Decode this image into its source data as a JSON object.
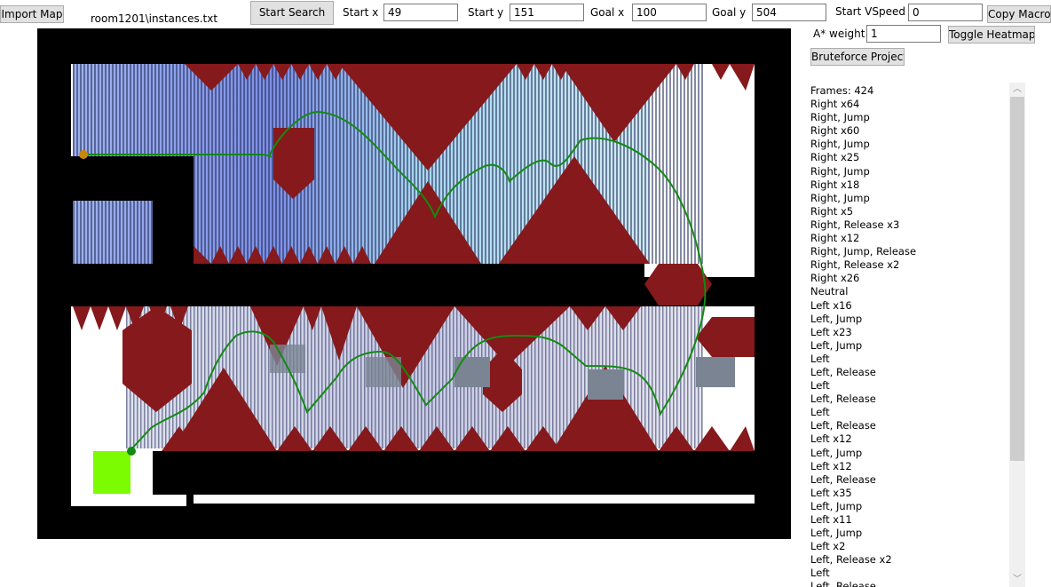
{
  "toolbar": {
    "import_label": "Import Map",
    "file_name": "room1201\\instances.txt",
    "start_search_label": "Start Search",
    "start_x_label": "Start x",
    "start_x_value": "49",
    "start_y_label": "Start y",
    "start_y_value": "151",
    "goal_x_label": "Goal x",
    "goal_x_value": "100",
    "goal_y_label": "Goal y",
    "goal_y_value": "504",
    "vspeed_label": "Start VSpeed",
    "vspeed_value": "0",
    "copy_macro_label": "Copy Macro",
    "astar_label": "A* weight",
    "astar_value": "1",
    "toggle_heatmap_label": "Toggle Heatmap",
    "bruteforce_label": "Bruteforce Project"
  },
  "map": {
    "colors": {
      "wall": "#000000",
      "hazard": "#85191b",
      "floor": "#ffffff",
      "goal": "#7cfc00",
      "path": "#138a13",
      "start_marker": "#c8860a",
      "block": "#7a8493"
    },
    "icons": [
      "start-marker",
      "goal-block",
      "player-dot"
    ]
  },
  "log": {
    "items": [
      "Frames: 424",
      "Right x64",
      "Right, Jump",
      "Right x60",
      "Right, Jump",
      "Right x25",
      "Right, Jump",
      "Right x18",
      "Right, Jump",
      "Right x5",
      "Right, Release x3",
      "Right x12",
      "Right, Jump, Release",
      "Right, Release x2",
      "Right x26",
      "Neutral",
      "Left x16",
      "Left, Jump",
      "Left x23",
      "Left, Jump",
      "Left",
      "Left, Release",
      "Left",
      "Left, Release",
      "Left",
      "Left, Release",
      "Left x12",
      "Left, Jump",
      "Left x12",
      "Left, Release",
      "Left x35",
      "Left, Jump",
      "Left x11",
      "Left, Jump",
      "Left x2",
      "Left, Release x2",
      "Left",
      "Left, Release"
    ]
  }
}
